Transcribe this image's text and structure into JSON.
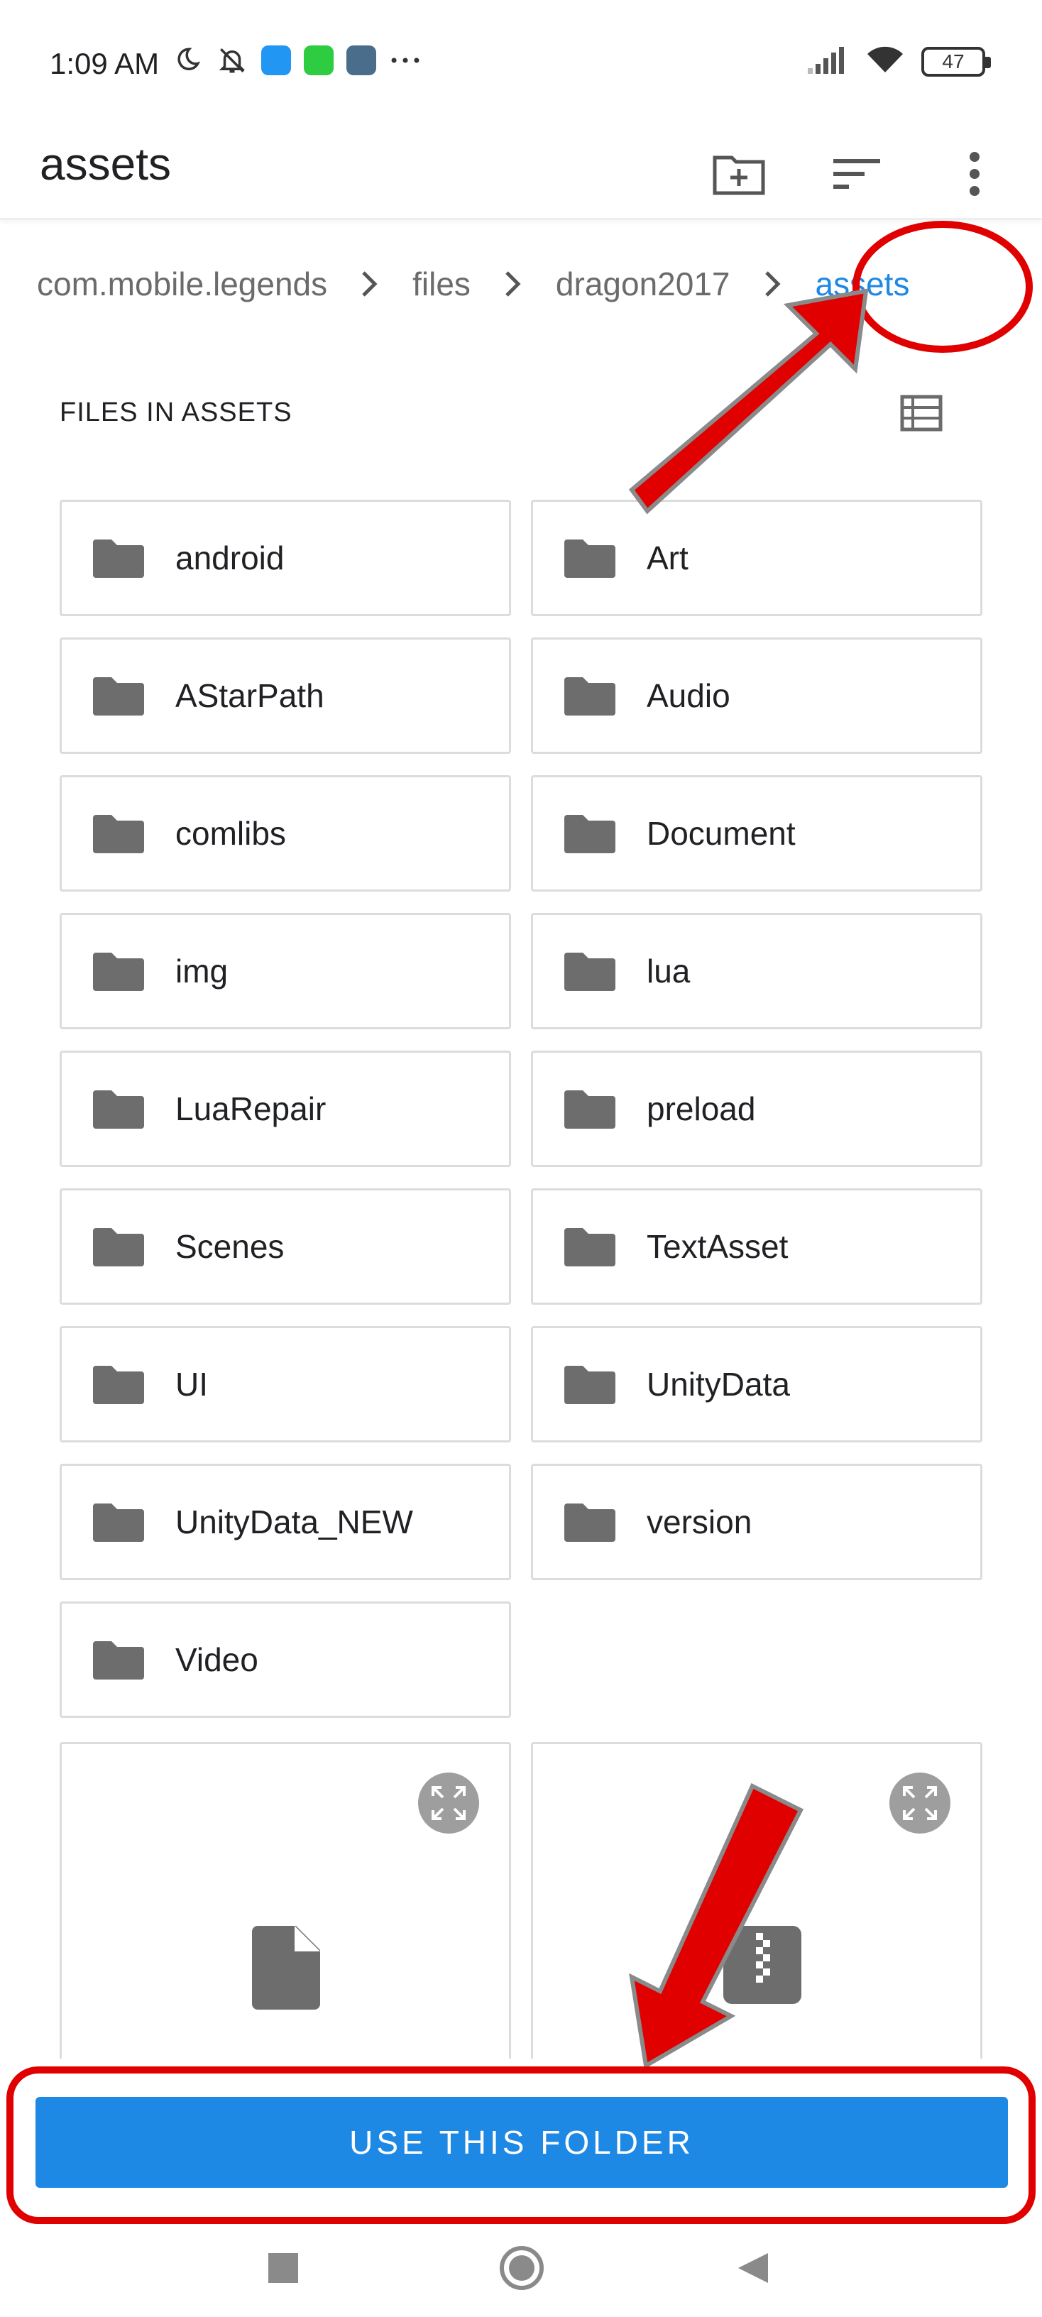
{
  "status_bar": {
    "time": "1:09 AM",
    "battery": "47",
    "left_icons": [
      "moon-icon",
      "bell-off-icon",
      "messages-app-icon",
      "line-app-icon",
      "settings-app-icon",
      "more-dots-icon"
    ],
    "right_icons": [
      "signal-icon",
      "wifi-icon",
      "battery-icon"
    ]
  },
  "app_bar": {
    "title": "assets",
    "actions": [
      "new-folder-icon",
      "sort-icon",
      "overflow-menu-icon"
    ]
  },
  "breadcrumb": {
    "items": [
      "com.mobile.legends",
      "files",
      "dragon2017",
      "assets"
    ]
  },
  "section": {
    "title": "FILES IN ASSETS"
  },
  "folders": [
    {
      "label": "android"
    },
    {
      "label": "Art"
    },
    {
      "label": "AStarPath"
    },
    {
      "label": "Audio"
    },
    {
      "label": "comlibs"
    },
    {
      "label": "Document"
    },
    {
      "label": "img"
    },
    {
      "label": "lua"
    },
    {
      "label": "LuaRepair"
    },
    {
      "label": "preload"
    },
    {
      "label": "Scenes"
    },
    {
      "label": "TextAsset"
    },
    {
      "label": "UI"
    },
    {
      "label": "UnityData"
    },
    {
      "label": "UnityData_NEW"
    },
    {
      "label": "version"
    },
    {
      "label": "Video"
    }
  ],
  "files": [
    {
      "icon": "document-file-icon"
    },
    {
      "icon": "archive-file-icon"
    }
  ],
  "bottom": {
    "button_label": "USE THIS FOLDER"
  },
  "colors": {
    "accent": "#1e88e5",
    "annotation": "#e00000",
    "folder_icon": "#6d6d6d"
  }
}
